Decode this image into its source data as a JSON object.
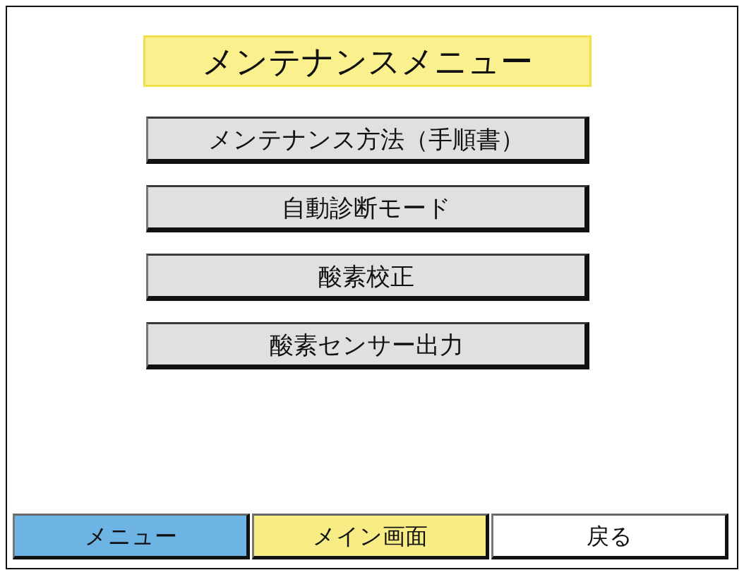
{
  "title": "メンテナンスメニュー",
  "menu_buttons": [
    {
      "label": "メンテナンス方法（手順書）"
    },
    {
      "label": "自動診断モード"
    },
    {
      "label": "酸素校正"
    },
    {
      "label": "酸素センサー出力"
    }
  ],
  "footer_buttons": [
    {
      "label": "メニュー",
      "color": "#6db3e3"
    },
    {
      "label": "メイン画面",
      "color": "#f8ec84"
    },
    {
      "label": "戻る",
      "color": "#ffffff"
    }
  ]
}
